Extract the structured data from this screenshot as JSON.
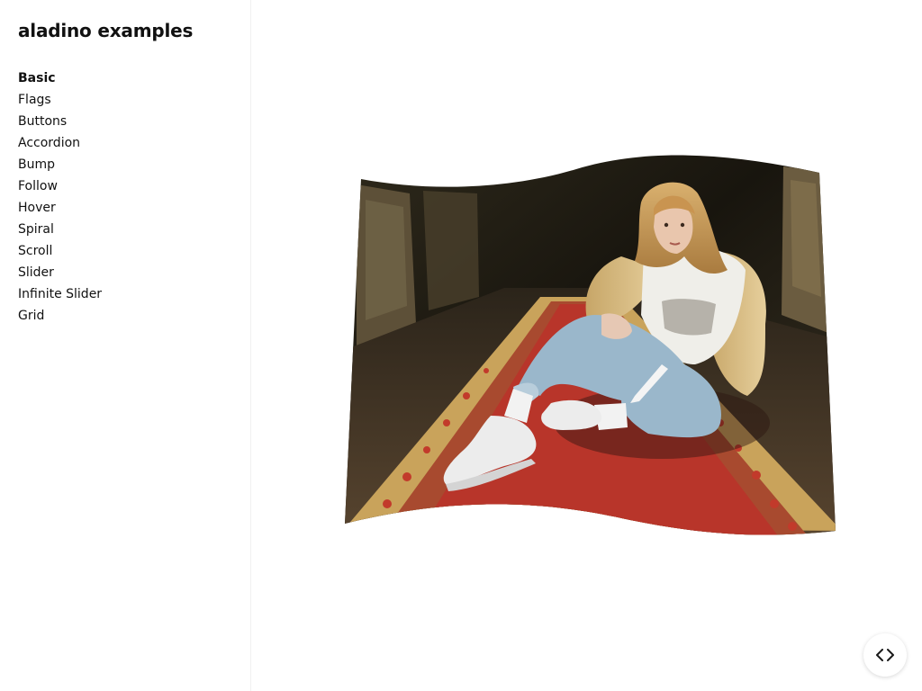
{
  "sidebar": {
    "title": "aladino examples",
    "items": [
      {
        "label": "Basic",
        "active": true
      },
      {
        "label": "Flags",
        "active": false
      },
      {
        "label": "Buttons",
        "active": false
      },
      {
        "label": "Accordion",
        "active": false
      },
      {
        "label": "Bump",
        "active": false
      },
      {
        "label": "Follow",
        "active": false
      },
      {
        "label": "Hover",
        "active": false
      },
      {
        "label": "Spiral",
        "active": false
      },
      {
        "label": "Scroll",
        "active": false
      },
      {
        "label": "Slider",
        "active": false
      },
      {
        "label": "Infinite Slider",
        "active": false
      },
      {
        "label": "Grid",
        "active": false
      }
    ]
  },
  "main": {
    "image": {
      "subject": "photo-of-person-sitting-on-red-carpet-runner",
      "effect": "wave-distortion"
    }
  },
  "code_button": {
    "icon": "code-brackets-icon"
  },
  "colors": {
    "text": "#111111",
    "sidebar_border": "#f1f1f1",
    "carpet_red": "#b8352a",
    "jeans_blue": "#9ab7cb"
  }
}
